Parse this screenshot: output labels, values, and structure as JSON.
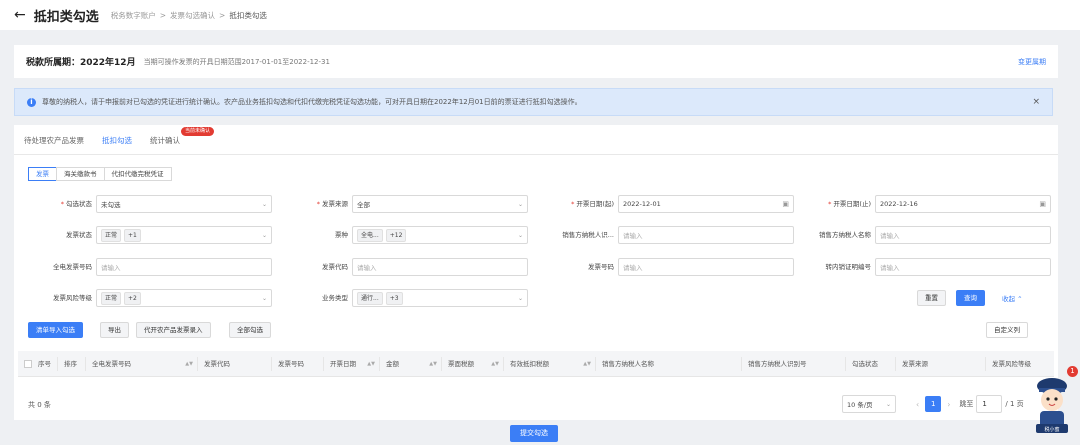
{
  "header": {
    "back_icon": "arrow-left-icon",
    "title": "抵扣类勾选",
    "breadcrumb": [
      "税务数字账户",
      "发票勾选确认",
      "抵扣类勾选"
    ]
  },
  "period": {
    "label": "税款所属期：2022年12月",
    "range": "当期可操作发票的开具日期范围2017-01-01至2022-12-31",
    "change": "变更属期"
  },
  "alert": {
    "text": "尊敬的纳税人，请于申报前对已勾选的凭证进行统计确认。农产品业务抵扣勾选和代扣代缴完税凭证勾选功能，可对开具日期在2022年12月01日前的票证进行抵扣勾选操作。",
    "close": "×"
  },
  "tabs": [
    {
      "label": "待处理农产品发票"
    },
    {
      "label": "抵扣勾选"
    },
    {
      "label": "统计确认",
      "badge": "当前未确认"
    }
  ],
  "subtabs": [
    "发票",
    "海关缴款书",
    "代扣代缴完税凭证"
  ],
  "filters": {
    "check_status": {
      "label": "勾选状态",
      "value": "未勾选"
    },
    "invoice_source": {
      "label": "发票来源",
      "value": "全部"
    },
    "date_start": {
      "label": "开票日期(起)",
      "value": "2022-12-01"
    },
    "date_end": {
      "label": "开票日期(止)",
      "value": "2022-12-16"
    },
    "invoice_status": {
      "label": "发票状态",
      "tags": [
        "正常",
        "+1"
      ]
    },
    "ticket_type": {
      "label": "票种",
      "tags": [
        "全电...",
        "+12"
      ]
    },
    "seller_tax_id": {
      "label": "销售方纳税人识...",
      "placeholder": "请输入"
    },
    "seller_name": {
      "label": "销售方纳税人名称",
      "placeholder": "请输入"
    },
    "full_invoice_no": {
      "label": "全电发票号码",
      "placeholder": "请输入"
    },
    "invoice_code": {
      "label": "发票代码",
      "placeholder": "请输入"
    },
    "invoice_no": {
      "label": "发票号码",
      "placeholder": "请输入"
    },
    "transfer_no": {
      "label": "转内销证明编号",
      "placeholder": "请输入"
    },
    "risk_level": {
      "label": "发票风险等级",
      "tags": [
        "正常",
        "+2"
      ]
    },
    "business_type": {
      "label": "业务类型",
      "tags": [
        "通行...",
        "+3"
      ]
    }
  },
  "buttons": {
    "reset": "重置",
    "query": "查询",
    "collapse": "收起",
    "import": "清单导入勾选",
    "export": "导出",
    "agri_entry": "代开农产品发票录入",
    "select_all": "全部勾选",
    "custom_cols": "自定义列",
    "submit": "提交勾选"
  },
  "table": {
    "columns": [
      "序号",
      "排序",
      "全电发票号码",
      "发票代码",
      "发票号码",
      "开票日期",
      "金额",
      "票面税额",
      "有效抵扣税额",
      "销售方纳税人名称",
      "销售方纳税人识别号",
      "勾选状态",
      "发票来源",
      "发票风险等级"
    ]
  },
  "pagination": {
    "total": "共 0 条",
    "page_size": "10 条/页",
    "current": "1",
    "goto_label": "跳至",
    "goto_value": "1",
    "pages": "/ 1 页"
  },
  "assistant": {
    "badge": "1",
    "caption": "税小蜜"
  },
  "colors": {
    "accent": "#3b7ef6",
    "badge": "#e23b32",
    "alert_bg": "#dce9fb"
  }
}
